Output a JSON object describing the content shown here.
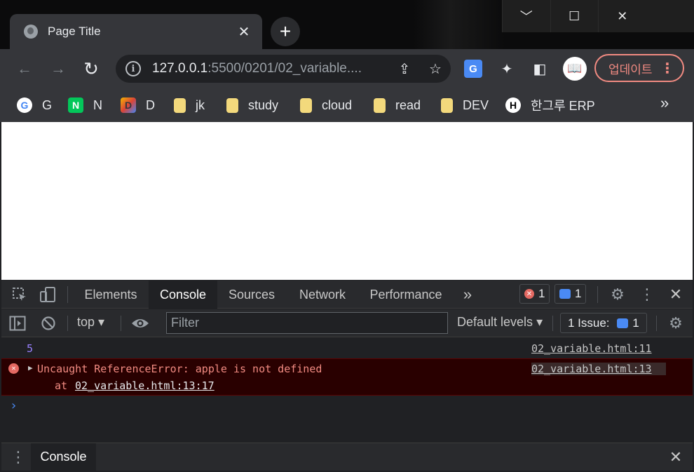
{
  "window": {
    "minimize": "﹀",
    "maximize": "☐",
    "close": "✕"
  },
  "tab": {
    "title": "Page Title",
    "close": "✕",
    "new_tab": "+"
  },
  "toolbar": {
    "back": "←",
    "forward": "→",
    "reload": "↻",
    "url_host": "127.0.0.1",
    "url_rest": ":5500/0201/02_variable....",
    "info": "i",
    "share": "⇪",
    "star": "☆",
    "translate": "G",
    "extensions": "✦",
    "sidepanel": "◧",
    "profile": "📖",
    "update_label": "업데이트",
    "menu": "⋮"
  },
  "bookmarks": [
    {
      "label": "G",
      "icon": "google-icon"
    },
    {
      "label": "N",
      "icon": "naver-icon"
    },
    {
      "label": "D",
      "icon": "d-icon"
    },
    {
      "label": "jk",
      "icon": "folder-icon"
    },
    {
      "label": "study",
      "icon": "folder-icon"
    },
    {
      "label": "cloud",
      "icon": "folder-icon"
    },
    {
      "label": "read",
      "icon": "folder-icon"
    },
    {
      "label": "DEV",
      "icon": "folder-icon"
    },
    {
      "label": "한그루 ERP",
      "icon": "erp-icon"
    }
  ],
  "bookmarks_more": "»",
  "devtools": {
    "tabs": [
      "Elements",
      "Console",
      "Sources",
      "Network",
      "Performance"
    ],
    "more_tabs": "»",
    "error_count": "1",
    "message_count": "1",
    "context": "top",
    "filter_placeholder": "Filter",
    "levels": "Default levels",
    "issues_label": "1 Issue:",
    "issues_count": "1",
    "close": "✕",
    "kebab": "⋮"
  },
  "console": {
    "log_value": "5",
    "log_source": "02_variable.html:11",
    "error_message": "Uncaught ReferenceError: apple is not defined",
    "error_at": "at",
    "error_location": "02_variable.html:13:17",
    "error_source": "02_variable.html:13",
    "prompt": "›"
  },
  "drawer": {
    "tab": "Console",
    "menu": "⋮",
    "close": "✕"
  },
  "colors": {
    "accent_blue": "#4a8af4",
    "error_red": "#f28b82",
    "update_red": "#f28b82",
    "log_number": "#9980ff"
  }
}
